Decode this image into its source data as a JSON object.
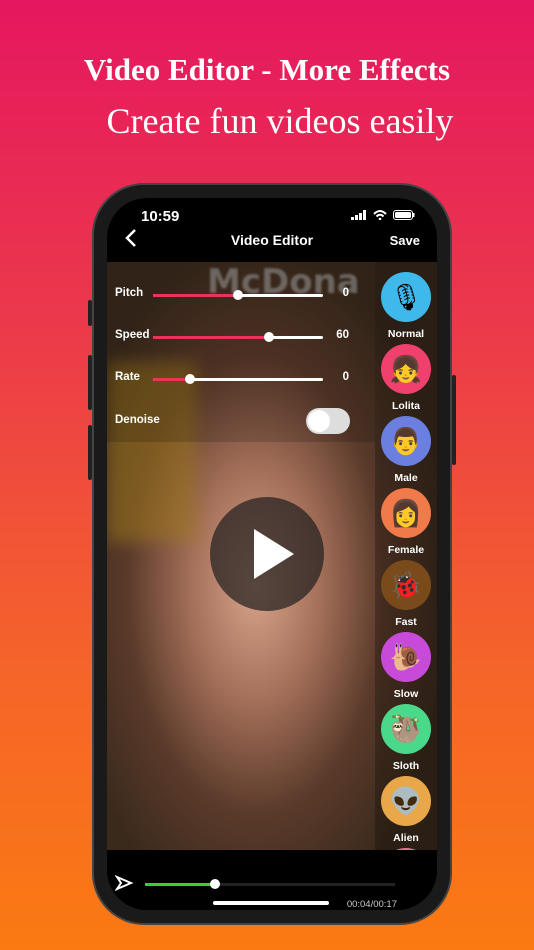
{
  "headline": "Video Editor - More Effects",
  "subheadline": "Create fun videos easily",
  "status": {
    "time": "10:59"
  },
  "nav": {
    "title": "Video Editor",
    "save_label": "Save",
    "back_icon": "chevron-left-icon"
  },
  "controls": [
    {
      "label": "Pitch",
      "value": "0",
      "position": 0.5
    },
    {
      "label": "Speed",
      "value": "60",
      "position": 0.68
    },
    {
      "label": "Rate",
      "value": "0",
      "position": 0.22
    }
  ],
  "denoise": {
    "label": "Denoise",
    "on": false
  },
  "effects": [
    {
      "label": "Normal",
      "icon": "microphone-icon",
      "glyph": "🎙",
      "color": "#3fb8ec"
    },
    {
      "label": "Lolita",
      "icon": "girl-face-icon",
      "glyph": "👧",
      "color": "#f0416e"
    },
    {
      "label": "Male",
      "icon": "man-face-icon",
      "glyph": "👨",
      "color": "#6a7fe0"
    },
    {
      "label": "Female",
      "icon": "woman-face-icon",
      "glyph": "👩",
      "color": "#f07a4a"
    },
    {
      "label": "Fast",
      "icon": "fast-icon",
      "glyph": "🐞",
      "color": "#7a4a1a"
    },
    {
      "label": "Slow",
      "icon": "snail-icon",
      "glyph": "🐌",
      "color": "#c84ad8"
    },
    {
      "label": "Sloth",
      "icon": "sloth-icon",
      "glyph": "🦥",
      "color": "#4ad88a"
    },
    {
      "label": "Alien",
      "icon": "alien-icon",
      "glyph": "👽",
      "color": "#e8a84a"
    }
  ],
  "player": {
    "progress": 0.28,
    "time": "00:04/00:17",
    "accent": "#2ed52e"
  }
}
